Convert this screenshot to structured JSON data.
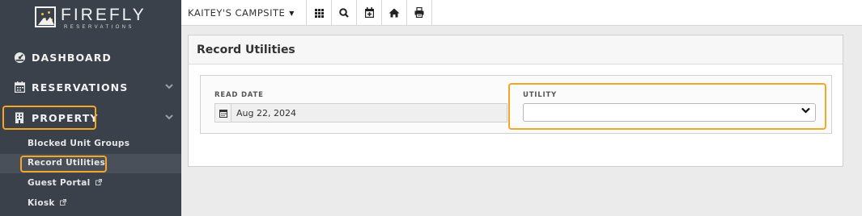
{
  "brand": {
    "name": "FIREFLY",
    "tagline": "RESERVATIONS"
  },
  "sidebar": {
    "items": [
      {
        "label": "DASHBOARD",
        "icon": "dashboard-icon"
      },
      {
        "label": "RESERVATIONS",
        "icon": "calendar-icon",
        "expandable": true
      },
      {
        "label": "PROPERTY",
        "icon": "building-icon",
        "expandable": true,
        "highlighted": true
      }
    ],
    "property_subitems": [
      {
        "label": "Blocked Unit Groups",
        "external": false
      },
      {
        "label": "Record Utilities",
        "external": false,
        "active": true,
        "highlighted": true
      },
      {
        "label": "Guest Portal",
        "external": true
      },
      {
        "label": "Kiosk",
        "external": true
      }
    ]
  },
  "topbar": {
    "campsite_selector": "KAITEY'S CAMPSITE",
    "buttons": [
      "grid-icon",
      "search-icon",
      "calendar-add-icon",
      "home-icon",
      "printer-icon"
    ]
  },
  "main": {
    "title": "Record Utilities",
    "read_date": {
      "label": "READ DATE",
      "value": "Aug 22, 2024"
    },
    "utility": {
      "label": "UTILITY",
      "value": ""
    }
  },
  "colors": {
    "sidebar_bg": "#3b414b",
    "highlight": "#f5a623",
    "logo_accent": "#f5c242",
    "page_bg": "#ebebeb"
  }
}
